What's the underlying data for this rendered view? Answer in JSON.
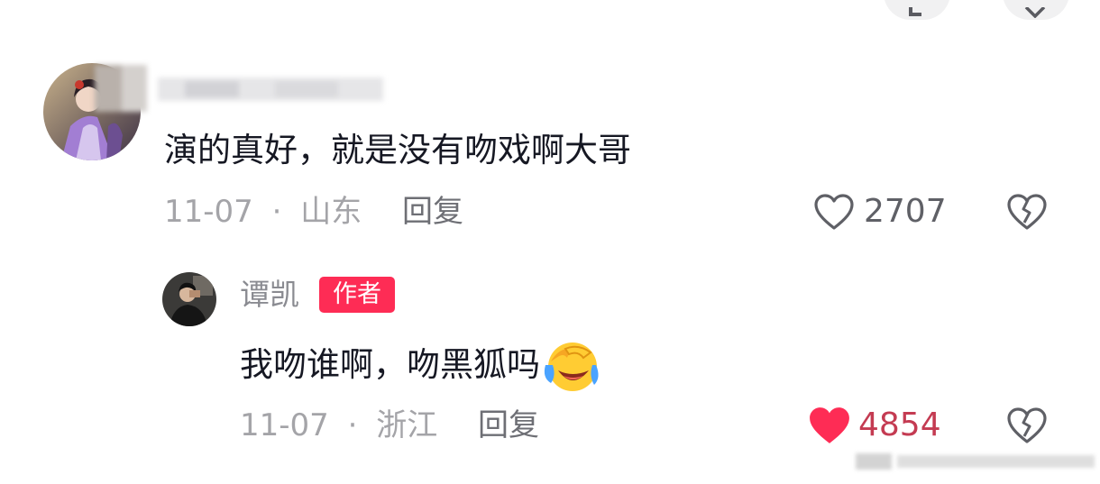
{
  "comment": {
    "text": "演的真好，就是没有吻戏啊大哥",
    "date": "11-07",
    "separator": "·",
    "location": "山东",
    "reply_label": "回复",
    "like_count": "2707",
    "liked": false
  },
  "reply": {
    "username": "谭凯",
    "badge": "作者",
    "text": "我吻谁啊，吻黑狐吗",
    "emoji": "crying-laughing-emoji",
    "date": "11-07",
    "separator": "·",
    "location": "浙江",
    "reply_label": "回复",
    "like_count": "4854",
    "liked": true
  },
  "colors": {
    "text": "#161823",
    "secondary": "#a4a4a8",
    "reply_text": "#6e6f75",
    "like_active": "#fe2c55",
    "badge_bg": "#fe2c55"
  },
  "icons": {
    "like": "heart-outline-icon",
    "liked": "heart-filled-icon",
    "dislike": "broken-heart-icon"
  }
}
